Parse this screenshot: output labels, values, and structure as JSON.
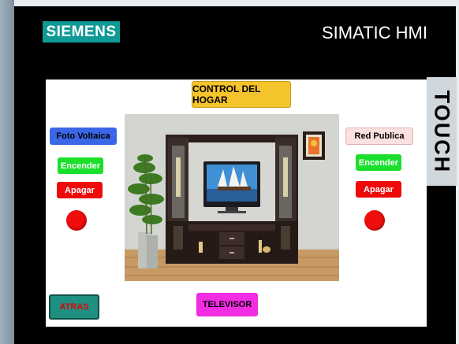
{
  "header": {
    "brand": "SIEMENS",
    "product": "SIMATIC HMI",
    "side_label": "TOUCH"
  },
  "screen": {
    "title_button": "CONTROL DEL HOGAR",
    "left": {
      "source_button": "Foto Voltaica",
      "on_button": "Encender",
      "off_button": "Apagar",
      "indicator_color": "#f00d0d"
    },
    "right": {
      "source_button": "Red Publica",
      "on_button": "Encender",
      "off_button": "Apagar",
      "indicator_color": "#f00d0d"
    },
    "back_button": "ATRAS",
    "device_button": "TELEVISOR"
  },
  "colors": {
    "brand_teal": "#0f9a96",
    "title_yellow": "#f5c32c",
    "on_green": "#1ae02d",
    "off_red": "#ee0a0a",
    "device_magenta": "#f22ce3"
  }
}
